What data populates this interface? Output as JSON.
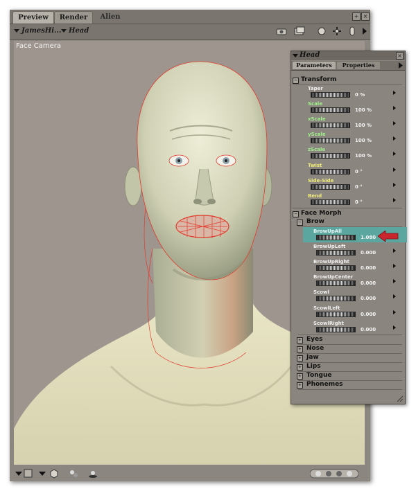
{
  "tabs": [
    "Preview",
    "Render",
    "Alien"
  ],
  "toolbar": {
    "figure_selector": "JamesHi...",
    "part_selector": "Head",
    "icons": [
      "camera-icon",
      "folder-icon",
      "light-icon",
      "move-icon",
      "figure-icon",
      "menu-arrow-icon"
    ]
  },
  "viewport": {
    "camera_label": "Face Camera",
    "background_color": "#9f958f",
    "skin_color": "#d8d3b8",
    "wire_color": "#e23a2a"
  },
  "panel": {
    "title": "Head",
    "tabs": [
      "Parameters",
      "Properties"
    ],
    "transform": {
      "label": "Transform",
      "params": [
        {
          "name": "Taper",
          "value": "0 %",
          "color": "#f0f0f0"
        },
        {
          "name": "Scale",
          "value": "100 %",
          "color": "#9ff08a"
        },
        {
          "name": "xScale",
          "value": "100 %",
          "color": "#9ff08a"
        },
        {
          "name": "yScale",
          "value": "100 %",
          "color": "#9ff08a"
        },
        {
          "name": "zScale",
          "value": "100 %",
          "color": "#9ff08a"
        },
        {
          "name": "Twist",
          "value": "0 °",
          "color": "#f0ec7a"
        },
        {
          "name": "Side-Side",
          "value": "0 °",
          "color": "#f0ec7a"
        },
        {
          "name": "Bend",
          "value": "0 °",
          "color": "#f0ec7a"
        }
      ]
    },
    "face_morph": {
      "label": "Face Morph",
      "brow": {
        "label": "Brow",
        "params": [
          {
            "name": "BrowUpAll",
            "value": "1.080",
            "color": "#e6f4f2",
            "selected": true
          },
          {
            "name": "BrowUpLeft",
            "value": "0.000",
            "color": "#f0f0f0"
          },
          {
            "name": "BrowUpRight",
            "value": "0.000",
            "color": "#f0f0f0"
          },
          {
            "name": "BrowUpCenter",
            "value": "0.000",
            "color": "#f0f0f0"
          },
          {
            "name": "Scowl",
            "value": "0.000",
            "color": "#f0f0f0"
          },
          {
            "name": "ScowlLeft",
            "value": "0.000",
            "color": "#f0f0f0"
          },
          {
            "name": "ScowlRight",
            "value": "0.000",
            "color": "#f0f0f0"
          }
        ]
      },
      "groups": [
        "Eyes",
        "Nose",
        "Jaw",
        "Lips",
        "Tongue",
        "Phonemes"
      ]
    },
    "highlight_color": "#5ba7a0",
    "arrow_color": "#c8262c"
  }
}
